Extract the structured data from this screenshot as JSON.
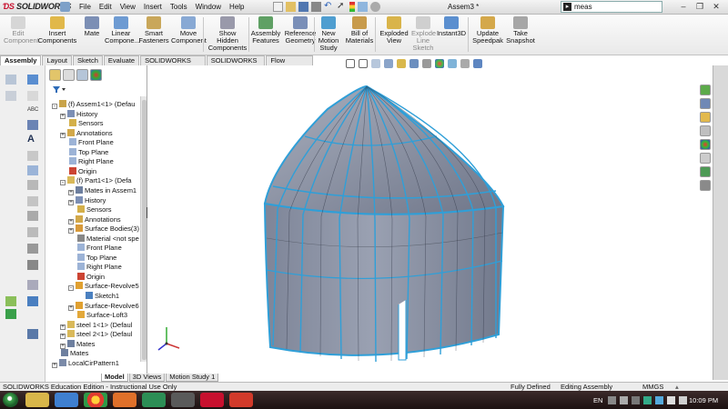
{
  "app": {
    "brand": "SOLIDWORKS",
    "document_title": "Assem3 *",
    "search_value": "meas"
  },
  "menu": [
    "File",
    "Edit",
    "View",
    "Insert",
    "Tools",
    "Window",
    "Help"
  ],
  "command_manager": [
    {
      "label": "Edit\nComponent",
      "icon": "edit-component-icon",
      "enabled": false
    },
    {
      "label": "Insert\nComponents",
      "icon": "insert-components-icon",
      "enabled": true
    },
    {
      "label": "Mate",
      "icon": "mate-icon",
      "enabled": true
    },
    {
      "label": "Linear\nCompone...",
      "icon": "linear-pattern-icon",
      "enabled": true
    },
    {
      "label": "Smart\nFasteners",
      "icon": "smart-fasteners-icon",
      "enabled": true
    },
    {
      "label": "Move\nComponent",
      "icon": "move-component-icon",
      "enabled": true
    },
    {
      "label": "Show\nHidden\nComponents",
      "icon": "show-hidden-icon",
      "enabled": true
    },
    {
      "label": "Assembly\nFeatures",
      "icon": "assembly-features-icon",
      "enabled": true
    },
    {
      "label": "Reference\nGeometry",
      "icon": "reference-geometry-icon",
      "enabled": true
    },
    {
      "label": "New\nMotion\nStudy",
      "icon": "motion-study-icon",
      "enabled": true
    },
    {
      "label": "Bill of\nMaterials",
      "icon": "bill-of-materials-icon",
      "enabled": true
    },
    {
      "label": "Exploded\nView",
      "icon": "exploded-view-icon",
      "enabled": true
    },
    {
      "label": "Explode\nLine\nSketch",
      "icon": "explode-line-icon",
      "enabled": false
    },
    {
      "label": "Instant3D",
      "icon": "instant3d-icon",
      "enabled": true
    },
    {
      "label": "Update\nSpeedpak",
      "icon": "speedpak-icon",
      "enabled": true
    },
    {
      "label": "Take\nSnapshot",
      "icon": "snapshot-icon",
      "enabled": true
    }
  ],
  "tabs": [
    "Assembly",
    "Layout",
    "Sketch",
    "Evaluate",
    "SOLIDWORKS Add-Ins",
    "SOLIDWORKS MBD",
    "Flow Simulation"
  ],
  "feature_tree": [
    {
      "label": "(f) Assem1<1> (Defau",
      "depth": 0,
      "expander": "-",
      "icon": "assembly"
    },
    {
      "label": "History",
      "depth": 1,
      "expander": "+",
      "icon": "history"
    },
    {
      "label": "Sensors",
      "depth": 1,
      "expander": "",
      "icon": "sensor"
    },
    {
      "label": "Annotations",
      "depth": 1,
      "expander": "+",
      "icon": "annotation"
    },
    {
      "label": "Front Plane",
      "depth": 1,
      "expander": "",
      "icon": "plane"
    },
    {
      "label": "Top Plane",
      "depth": 1,
      "expander": "",
      "icon": "plane"
    },
    {
      "label": "Right Plane",
      "depth": 1,
      "expander": "",
      "icon": "plane"
    },
    {
      "label": "Origin",
      "depth": 1,
      "expander": "",
      "icon": "origin"
    },
    {
      "label": "(f) Part1<1> (Defa",
      "depth": 1,
      "expander": "-",
      "icon": "part"
    },
    {
      "label": "Mates in Assem1",
      "depth": 2,
      "expander": "+",
      "icon": "mates"
    },
    {
      "label": "History",
      "depth": 2,
      "expander": "+",
      "icon": "history"
    },
    {
      "label": "Sensors",
      "depth": 2,
      "expander": "",
      "icon": "sensor"
    },
    {
      "label": "Annotations",
      "depth": 2,
      "expander": "+",
      "icon": "annotation"
    },
    {
      "label": "Surface Bodies(3)",
      "depth": 2,
      "expander": "+",
      "icon": "surface"
    },
    {
      "label": "Material <not spe",
      "depth": 2,
      "expander": "",
      "icon": "material"
    },
    {
      "label": "Front Plane",
      "depth": 2,
      "expander": "",
      "icon": "plane"
    },
    {
      "label": "Top Plane",
      "depth": 2,
      "expander": "",
      "icon": "plane"
    },
    {
      "label": "Right Plane",
      "depth": 2,
      "expander": "",
      "icon": "plane"
    },
    {
      "label": "Origin",
      "depth": 2,
      "expander": "",
      "icon": "origin"
    },
    {
      "label": "Surface-Revolve5",
      "depth": 2,
      "expander": "-",
      "icon": "revolve"
    },
    {
      "label": "Sketch1",
      "depth": 3,
      "expander": "",
      "icon": "sketch"
    },
    {
      "label": "Surface-Revolve6",
      "depth": 2,
      "expander": "+",
      "icon": "revolve"
    },
    {
      "label": "Surface-Loft3",
      "depth": 2,
      "expander": "",
      "icon": "loft"
    },
    {
      "label": "steel 1<1> (Defaul",
      "depth": 1,
      "expander": "+",
      "icon": "part"
    },
    {
      "label": "steel 2<1> (Defaul",
      "depth": 1,
      "expander": "+",
      "icon": "part"
    },
    {
      "label": "Mates",
      "depth": 1,
      "expander": "+",
      "icon": "mates"
    },
    {
      "label": "Mates",
      "depth": 0,
      "expander": "",
      "icon": "mates"
    },
    {
      "label": "LocalCirPattern1",
      "depth": 0,
      "expander": "+",
      "icon": "pattern"
    }
  ],
  "bottom_tabs": [
    "Model",
    "3D Views",
    "Motion Study 1"
  ],
  "status": {
    "edition": "SOLIDWORKS Education Edition - Instructional Use Only",
    "state": "Fully Defined",
    "mode": "Editing Assembly",
    "units": "MMGS"
  },
  "taskbar": {
    "language": "EN",
    "time": "10:09 PM"
  },
  "colors": {
    "model_face": "#8c93a6",
    "model_edge": "#2f9fd8",
    "brand_red": "#c8102e"
  }
}
